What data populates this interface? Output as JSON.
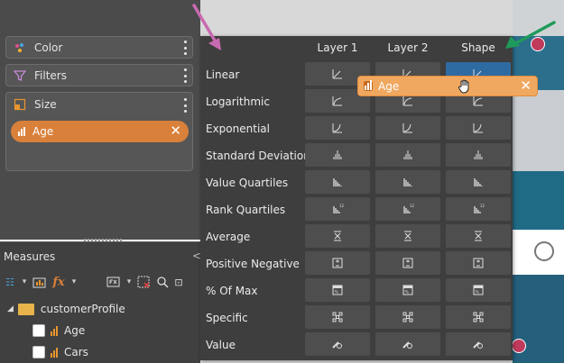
{
  "field_wells": {
    "color_label": "Color",
    "filters_label": "Filters",
    "size_label": "Size",
    "size_item": "Age"
  },
  "measures": {
    "title": "Measures",
    "folder": "customerProfile",
    "items": [
      "Age",
      "Cars"
    ]
  },
  "scaling_menu": {
    "columns": [
      "Layer 1",
      "Layer 2",
      "Shape"
    ],
    "rows": [
      "Linear",
      "Logarithmic",
      "Exponential",
      "Standard Deviation",
      "Value Quartiles",
      "Rank Quartiles",
      "Average",
      "Positive Negative",
      "% Of Max",
      "Specific",
      "Value"
    ],
    "active_cell": {
      "row": "Linear",
      "column": "Shape"
    }
  },
  "dragged_item": {
    "label": "Age"
  },
  "colors": {
    "accent_orange": "#d9803a",
    "drag_orange": "#f0a860",
    "active_blue": "#2f6ba3",
    "arrow_pink": "#c86bb0",
    "arrow_green": "#1f9a5b",
    "map_marker": "#c03a5c"
  },
  "icons": {
    "color": "palette-icon",
    "filters": "funnel-icon",
    "size": "size-icon",
    "measure": "bar-chart-icon",
    "folder": "folder-icon",
    "drag_cursor": "hand-icon"
  }
}
